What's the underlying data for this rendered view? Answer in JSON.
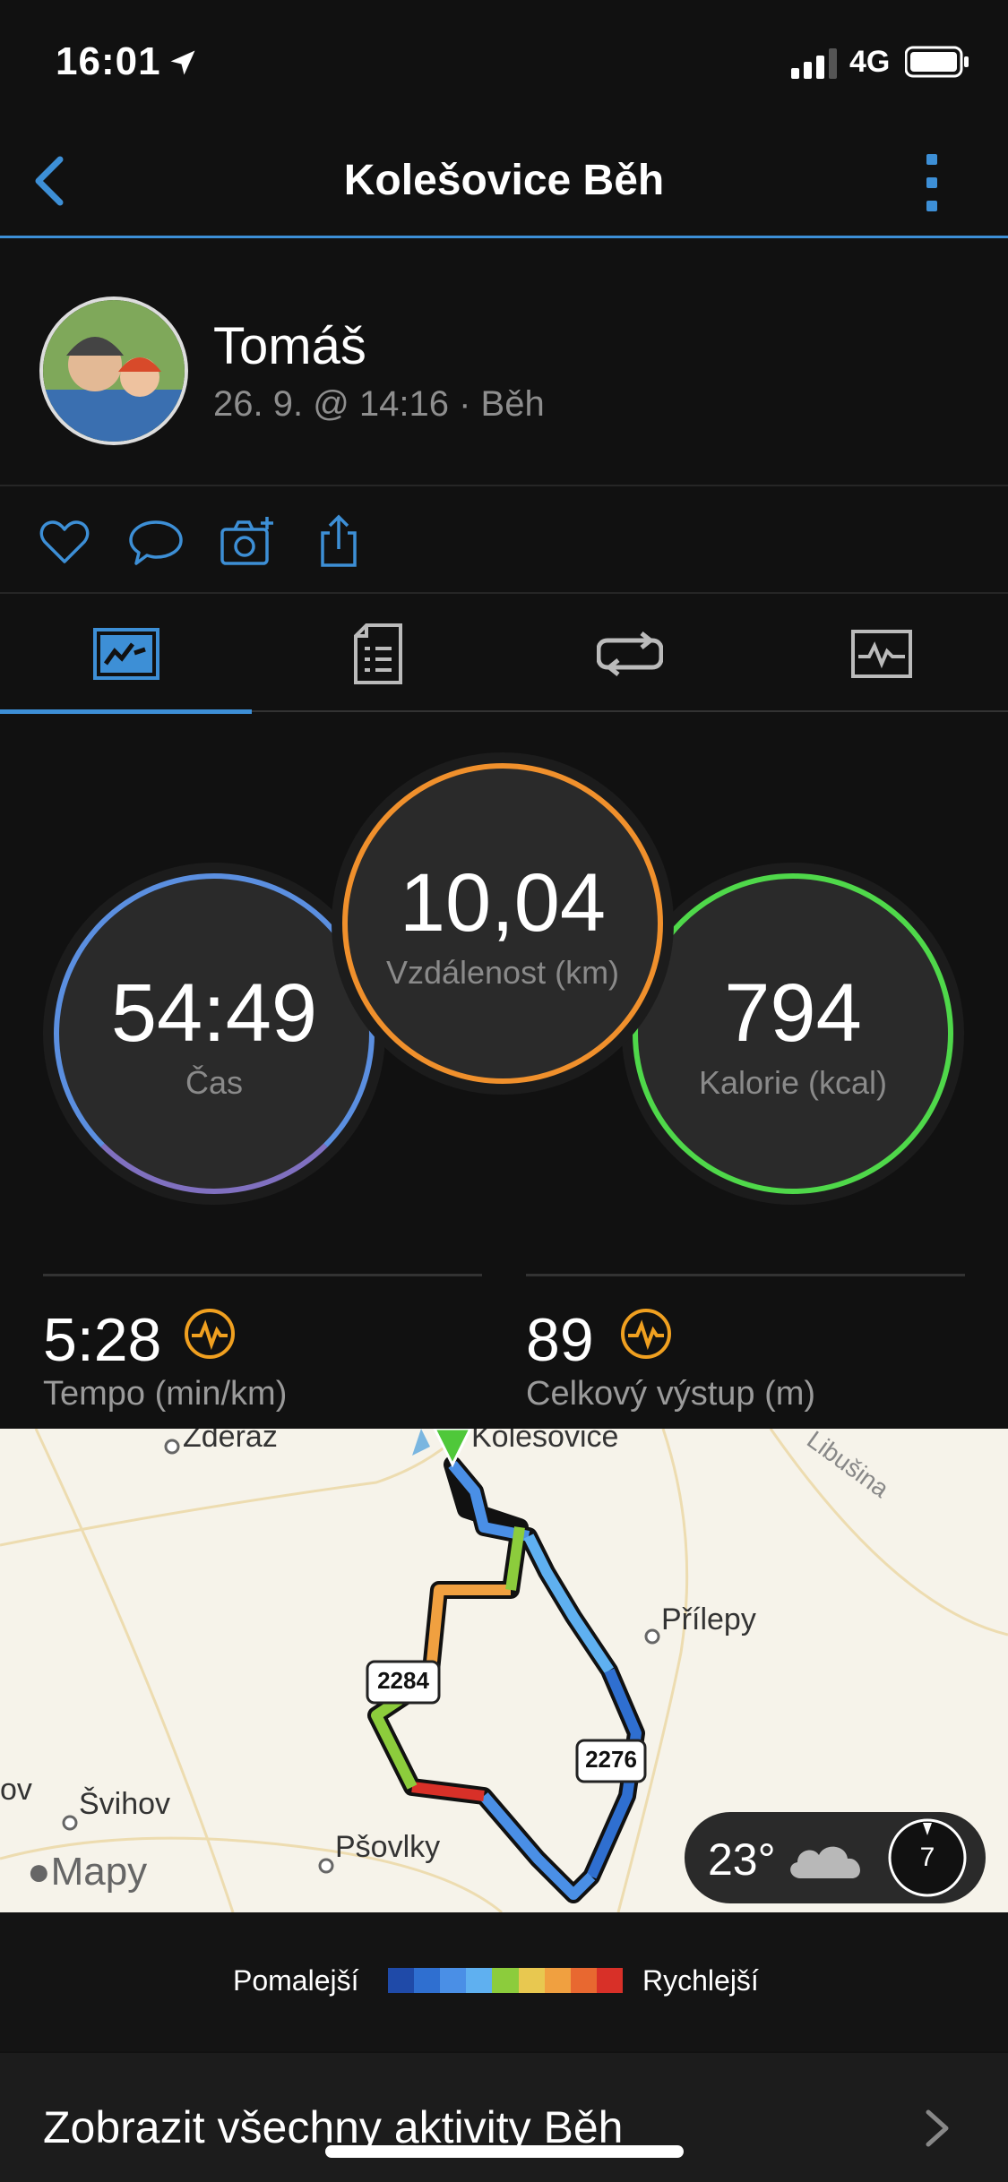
{
  "status": {
    "time": "16:01",
    "network": "4G"
  },
  "nav": {
    "title": "Kolešovice Běh"
  },
  "profile": {
    "name": "Tomáš",
    "meta": "26. 9. @ 14:16 · Běh"
  },
  "stats": {
    "time": {
      "value": "54:49",
      "label": "Čas"
    },
    "distance": {
      "value": "10,04",
      "label": "Vzdálenost (km)"
    },
    "calories": {
      "value": "794",
      "label": "Kalorie (kcal)"
    },
    "pace": {
      "value": "5:28",
      "label": "Tempo (min/km)"
    },
    "ascent": {
      "value": "89",
      "label": "Celkový výstup (m)"
    }
  },
  "map": {
    "places": [
      "Zderaz",
      "Kolešovice",
      "Libušina",
      "Přílepy",
      "Švihov",
      "Pšovlky",
      "ov"
    ],
    "roads": [
      "2284",
      "2276"
    ],
    "logo": "Mapy",
    "weather": {
      "temp": "23°",
      "wind": "7"
    }
  },
  "legend": {
    "slow": "Pomalejší",
    "fast": "Rychlejší",
    "colors": [
      "#1f4aa8",
      "#2f6fd0",
      "#4a8fe6",
      "#5fb0f0",
      "#8ccc3c",
      "#e8c850",
      "#f0a040",
      "#e86830",
      "#d83028"
    ]
  },
  "footer": {
    "all_activities": "Zobrazit všechny aktivity Běh"
  },
  "colors": {
    "accent": "#3d8fd6",
    "time_ring": "#5b8fe0",
    "distance_ring": "#f0902c",
    "calories_ring": "#4fd84a",
    "metric_icon": "#f0a020"
  }
}
